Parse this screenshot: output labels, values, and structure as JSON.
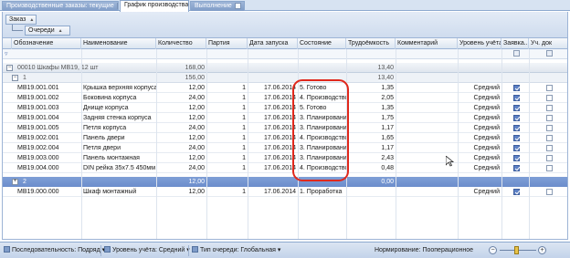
{
  "tabs": [
    {
      "label": "Производственные заказы: текущие",
      "active": false
    },
    {
      "label": "График производства",
      "active": true
    },
    {
      "label": "Выполнение",
      "active": false
    }
  ],
  "group_panel": {
    "chip1": "Заказ",
    "chip2": "Очереди"
  },
  "columns": {
    "code": "Обозначение",
    "name": "Наименование",
    "qty": "Количество",
    "batch": "Партия",
    "date": "Дата запуска",
    "state": "Состояние",
    "effort": "Трудоёмкость",
    "comment": "Комментарий",
    "level": "Уровень учёта",
    "req": "Заявка...",
    "acc": "Уч. док"
  },
  "group0": {
    "title": "00010 Шкафы МВ19, 12 шт",
    "qty": "168,00",
    "effort": "13,40"
  },
  "group1": {
    "title": "1",
    "qty": "156,00",
    "effort": "13,40"
  },
  "group2": {
    "title": "2",
    "qty": "12,00",
    "effort": "0,00"
  },
  "rows1": [
    {
      "code": "МВ19.001.001",
      "name": "Крышка верхняя корпуса",
      "qty": "12,00",
      "batch": "1",
      "date": "17.06.2014",
      "state": "5. Готово",
      "effort": "1,35",
      "level": "Средний",
      "req": true,
      "acc": false
    },
    {
      "code": "МВ19.001.002",
      "name": "Боковина корпуса",
      "qty": "24,00",
      "batch": "1",
      "date": "17.06.2014",
      "state": "4. Производство",
      "effort": "2,05",
      "level": "Средний",
      "req": true,
      "acc": false
    },
    {
      "code": "МВ19.001.003",
      "name": "Днище корпуса",
      "qty": "12,00",
      "batch": "1",
      "date": "17.06.2014",
      "state": "5. Готово",
      "effort": "1,35",
      "level": "Средний",
      "req": true,
      "acc": false
    },
    {
      "code": "МВ19.001.004",
      "name": "Задняя стенка корпуса",
      "qty": "12,00",
      "batch": "1",
      "date": "17.06.2014",
      "state": "3. Планирование",
      "effort": "1,75",
      "level": "Средний",
      "req": true,
      "acc": false
    },
    {
      "code": "МВ19.001.005",
      "name": "Петля корпуса",
      "qty": "24,00",
      "batch": "1",
      "date": "17.06.2014",
      "state": "3. Планирование",
      "effort": "1,17",
      "level": "Средний",
      "req": true,
      "acc": false
    },
    {
      "code": "МВ19.002.001",
      "name": "Панель двери",
      "qty": "12,00",
      "batch": "1",
      "date": "17.06.2014",
      "state": "4. Производство",
      "effort": "1,65",
      "level": "Средний",
      "req": true,
      "acc": false
    },
    {
      "code": "МВ19.002.004",
      "name": "Петля двери",
      "qty": "24,00",
      "batch": "1",
      "date": "17.06.2014",
      "state": "3. Планирование",
      "effort": "1,17",
      "level": "Средний",
      "req": true,
      "acc": false
    },
    {
      "code": "МВ19.003.000",
      "name": "Панель монтажная",
      "qty": "12,00",
      "batch": "1",
      "date": "17.06.2014",
      "state": "3. Планирование",
      "effort": "2,43",
      "level": "Средний",
      "req": true,
      "acc": false
    },
    {
      "code": "МВ19.004.000",
      "name": "DIN рейка 35х7.5 450мм",
      "qty": "24,00",
      "batch": "1",
      "date": "17.06.2014",
      "state": "4. Производство",
      "effort": "0,48",
      "level": "Средний",
      "req": true,
      "acc": false
    }
  ],
  "rows2": [
    {
      "code": "МВ19.000.000",
      "name": "Шкаф монтажный",
      "qty": "12,00",
      "batch": "1",
      "date": "17.06.2014",
      "state": "1. Проработка",
      "effort": "",
      "level": "Средний",
      "req": true,
      "acc": false
    }
  ],
  "statusbar": {
    "sequence": "Последовательность: Подряд",
    "level": "Уровень учёта: Средний",
    "queue_type": "Тип очереди: Глобальная",
    "norm": "Нормирование: Пооперационное"
  },
  "colors": {
    "accent": "#6b8dcc",
    "highlight": "#e0281c",
    "checkbox": "#5b7fc4"
  }
}
